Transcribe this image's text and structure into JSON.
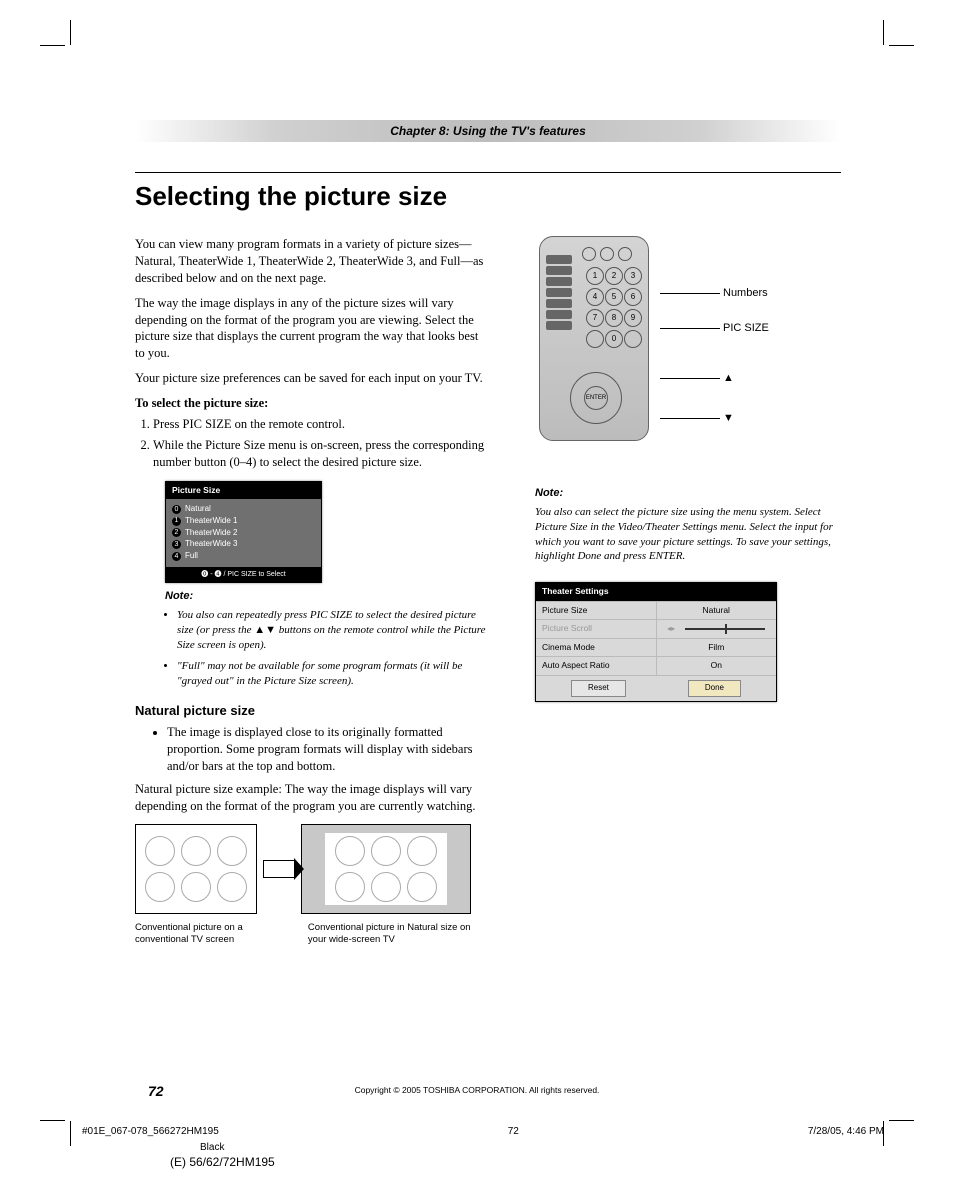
{
  "chapter_banner": "Chapter 8: Using the TV's features",
  "title": "Selecting the picture size",
  "para1": "You can view many program formats in a variety of picture sizes—Natural, TheaterWide 1, TheaterWide 2, TheaterWide 3, and Full—as described below and on the next page.",
  "para2": "The way the image displays in any of the picture sizes will vary depending on the format of the program you are viewing. Select the picture size that displays the current program the way that looks best to you.",
  "para3": "Your picture size preferences can be saved for each input on your TV.",
  "subhead": "To select the picture size:",
  "steps": [
    "Press PIC SIZE on the remote control.",
    "While the Picture Size menu is on-screen, press the corresponding number button (0–4) to select the desired picture size."
  ],
  "menu": {
    "title": "Picture Size",
    "items": [
      {
        "n": "0",
        "label": "Natural"
      },
      {
        "n": "1",
        "label": "TheaterWide 1"
      },
      {
        "n": "2",
        "label": "TheaterWide 2"
      },
      {
        "n": "3",
        "label": "TheaterWide 3"
      },
      {
        "n": "4",
        "label": "Full"
      }
    ],
    "foot": "⓿ - ❹  /  PIC SIZE  to Select"
  },
  "note_label_l": "Note:",
  "notes_l": [
    "You also can repeatedly press PIC SIZE to select the desired picture size (or press the ▲▼ buttons on the remote control while the Picture Size screen is open).",
    "\"Full\" may not be available for some program formats (it will be \"grayed out\" in the Picture Size screen)."
  ],
  "sec_natural": "Natural picture size",
  "natural_bullet": "The image is displayed close to its originally formatted proportion. Some program formats will display with sidebars and/or bars at the top and bottom.",
  "natural_para": "Natural picture size example: The way the image displays will vary depending on the format of the program you are currently watching.",
  "caption1": "Conventional picture on a conventional TV screen",
  "caption2": "Conventional picture in Natural size on your wide-screen TV",
  "remote_labels": {
    "numbers": "Numbers",
    "picsize": "PIC SIZE",
    "up": "▲",
    "down": "▼"
  },
  "remote_enter": "ENTER",
  "note_label_r": "Note:",
  "note_r": "You also can select the picture size using the menu system. Select Picture Size in the Video/Theater Settings menu. Select the input for which you want to save your picture settings.  To save your settings, highlight Done and press ENTER.",
  "theater": {
    "title": "Theater Settings",
    "rows": [
      {
        "k": "Picture Size",
        "v": "Natural"
      },
      {
        "k": "Picture Scroll",
        "v": "slider"
      },
      {
        "k": "Cinema Mode",
        "v": "Film"
      },
      {
        "k": "Auto Aspect Ratio",
        "v": "On"
      }
    ],
    "reset": "Reset",
    "done": "Done"
  },
  "page_number": "72",
  "copyright": "Copyright © 2005 TOSHIBA CORPORATION. All rights reserved.",
  "footer": {
    "file": "#01E_067-078_566272HM195",
    "pn": "72",
    "date": "7/28/05, 4:46 PM",
    "black": "Black",
    "model": "(E) 56/62/72HM195"
  }
}
